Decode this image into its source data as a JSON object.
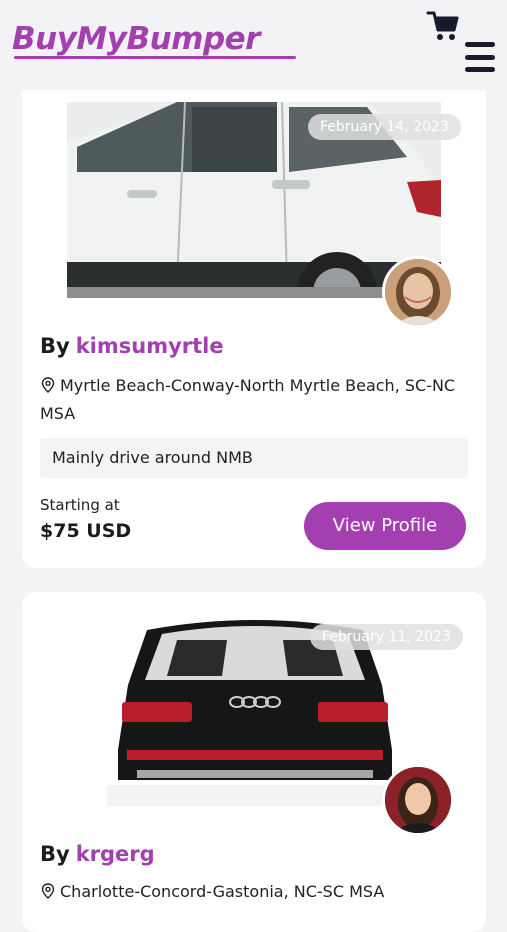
{
  "header": {
    "logo": "BuyMyBumper",
    "brand_color": "#a33fb0",
    "cart_icon": "cart-icon",
    "menu_icon": "hamburger-menu-icon"
  },
  "listings": [
    {
      "date": "February 14, 2023",
      "by_label": "By",
      "username": "kimsumyrtle",
      "location": "Myrtle Beach-Conway-North Myrtle Beach, SC-NC MSA",
      "note": "Mainly drive around NMB",
      "starting_label": "Starting at",
      "price": "$75 USD",
      "button_label": "View Profile"
    },
    {
      "date": "February 11, 2023",
      "by_label": "By",
      "username": "krgerg",
      "location": "Charlotte-Concord-Gastonia, NC-SC MSA"
    }
  ]
}
